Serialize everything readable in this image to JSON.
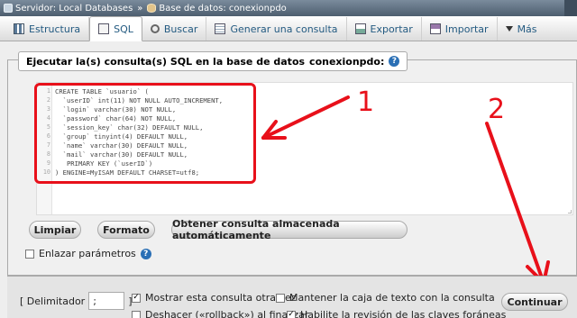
{
  "breadcrumb": {
    "server": "Servidor: Local Databases",
    "separator": "»",
    "database": "Base de datos: conexionpdo"
  },
  "tabs": [
    {
      "label": "Estructura",
      "icon": "structure-icon"
    },
    {
      "label": "SQL",
      "icon": "sql-icon"
    },
    {
      "label": "Buscar",
      "icon": "search-icon"
    },
    {
      "label": "Generar una consulta",
      "icon": "query-icon"
    },
    {
      "label": "Exportar",
      "icon": "export-icon"
    },
    {
      "label": "Importar",
      "icon": "import-icon"
    },
    {
      "label": "Más",
      "icon": "chevron-down-icon"
    }
  ],
  "active_tab": "SQL",
  "sql_panel": {
    "legend": "Ejecutar la(s) consulta(s) SQL en la base de datos",
    "database": "conexionpdo:",
    "code_lines": [
      "CREATE TABLE `usuario` (",
      "  `userID` int(11) NOT NULL AUTO_INCREMENT,",
      "  `login` varchar(30) NOT NULL,",
      "  `password` char(64) NOT NULL,",
      "  `session_key` char(32) DEFAULT NULL,",
      "  `group` tinyint(4) DEFAULT NULL,",
      "  `name` varchar(30) DEFAULT NULL,",
      "  `mail` varchar(30) DEFAULT NULL,",
      "   PRIMARY KEY (`userID`)",
      ") ENGINE=MyISAM DEFAULT CHARSET=utf8;"
    ],
    "line_numbers": [
      "1",
      "2",
      "3",
      "4",
      "5",
      "6",
      "7",
      "8",
      "9",
      "10"
    ]
  },
  "buttons": {
    "clear": "Limpiar",
    "format": "Formato",
    "saved_query": "Obtener consulta almacenada automáticamente",
    "continue": "Continuar"
  },
  "options": {
    "bind_params": "Enlazar parámetros",
    "delimiter_label": "[ Delimitador",
    "delimiter_value": ";",
    "delimiter_close": "]",
    "show_query": "Mostrar esta consulta otra vez",
    "keep_textbox": "Mantener la caja de texto con la consulta",
    "rollback": "Deshacer («rollback») al finalizar",
    "foreign_keys": "Habilite la revisión de las claves foráneas"
  },
  "annotations": {
    "label_1": "1",
    "label_2": "2",
    "color": "#e8101a"
  }
}
